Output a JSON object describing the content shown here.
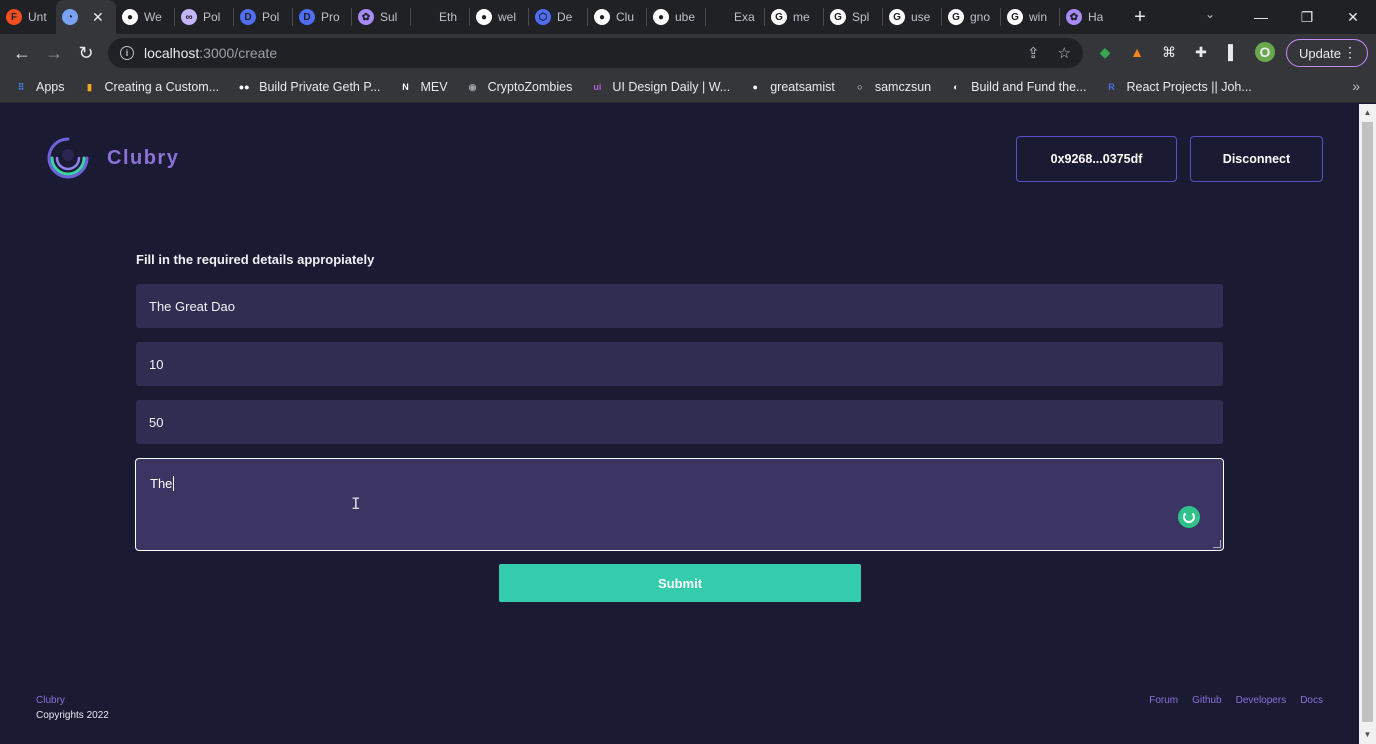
{
  "browser": {
    "tabs": [
      {
        "title": "Unt",
        "icon": "figma-icon",
        "color": "#f24e1e",
        "glyph": "F"
      },
      {
        "title": "",
        "icon": "clubry-icon",
        "color": "#7aa2f7",
        "glyph": "◔",
        "active": true
      },
      {
        "title": "We",
        "icon": "github-icon",
        "color": "#ffffff",
        "glyph": "●"
      },
      {
        "title": "Pol",
        "icon": "polygon-icon",
        "color": "#c4b5fd",
        "glyph": "∞"
      },
      {
        "title": "Pol",
        "icon": "docs-icon",
        "color": "#4f6df5",
        "glyph": "D"
      },
      {
        "title": "Pro",
        "icon": "docs-icon",
        "color": "#4f6df5",
        "glyph": "D"
      },
      {
        "title": "Sul",
        "icon": "web-icon",
        "color": "#a78bfa",
        "glyph": "✿"
      },
      {
        "title": "Eth",
        "icon": "blank-icon",
        "color": "#202124",
        "glyph": ""
      },
      {
        "title": "wel",
        "icon": "github-icon",
        "color": "#ffffff",
        "glyph": "●"
      },
      {
        "title": "De",
        "icon": "hex-icon",
        "color": "#4f6df5",
        "glyph": "⬡"
      },
      {
        "title": "Clu",
        "icon": "github-icon",
        "color": "#ffffff",
        "glyph": "●"
      },
      {
        "title": "ube",
        "icon": "github-icon",
        "color": "#ffffff",
        "glyph": "●"
      },
      {
        "title": "Exa",
        "icon": "blank-icon",
        "color": "#202124",
        "glyph": ""
      },
      {
        "title": "me",
        "icon": "google-icon",
        "color": "#ffffff",
        "glyph": "G"
      },
      {
        "title": "Spl",
        "icon": "google-icon",
        "color": "#ffffff",
        "glyph": "G"
      },
      {
        "title": "use",
        "icon": "google-icon",
        "color": "#ffffff",
        "glyph": "G"
      },
      {
        "title": "gno",
        "icon": "google-icon",
        "color": "#ffffff",
        "glyph": "G"
      },
      {
        "title": "win",
        "icon": "google-icon",
        "color": "#ffffff",
        "glyph": "G"
      },
      {
        "title": "Ha",
        "icon": "web-icon",
        "color": "#a78bfa",
        "glyph": "✿"
      }
    ],
    "url_host": "localhost",
    "url_path": ":3000/create",
    "update_label": "Update",
    "profile_initial": "O",
    "bookmarks": [
      {
        "label": "Apps",
        "icon": "apps-grid-icon",
        "color": "#4285f4",
        "glyph": "⠿"
      },
      {
        "label": "Creating a Custom...",
        "icon": "bookmark-flag-icon",
        "color": "#f5a623",
        "glyph": "▮"
      },
      {
        "label": "Build Private Geth P...",
        "icon": "medium-icon",
        "color": "#ffffff",
        "glyph": "●●"
      },
      {
        "label": "MEV",
        "icon": "notion-icon",
        "color": "#ffffff",
        "glyph": "N"
      },
      {
        "label": "CryptoZombies",
        "icon": "zombie-icon",
        "color": "#9aa0a6",
        "glyph": "◉"
      },
      {
        "label": "UI Design Daily | W...",
        "icon": "uidesign-icon",
        "color": "#b05bdc",
        "glyph": "ui"
      },
      {
        "label": "greatsamist",
        "icon": "github-icon",
        "color": "#ffffff",
        "glyph": "●"
      },
      {
        "label": "samczsun",
        "icon": "circle-icon",
        "color": "#ffffff",
        "glyph": "○"
      },
      {
        "label": "Build and Fund the...",
        "icon": "gitcoin-icon",
        "color": "#ffffff",
        "glyph": "◐"
      },
      {
        "label": "React Projects || Joh...",
        "icon": "replit-icon",
        "color": "#4f6df5",
        "glyph": "R"
      }
    ]
  },
  "header": {
    "brand": "Clubry",
    "address_label": "0x9268...0375df",
    "disconnect_label": "Disconnect"
  },
  "form": {
    "title": "Fill in the required details appropiately",
    "name_value": "The Great Dao",
    "field2_value": "10",
    "field3_value": "50",
    "description_value": "The",
    "submit_label": "Submit"
  },
  "footer": {
    "brand": "Clubry",
    "copyright": "Copyrights 2022",
    "links": [
      "Forum",
      "Github",
      "Developers",
      "Docs"
    ]
  }
}
